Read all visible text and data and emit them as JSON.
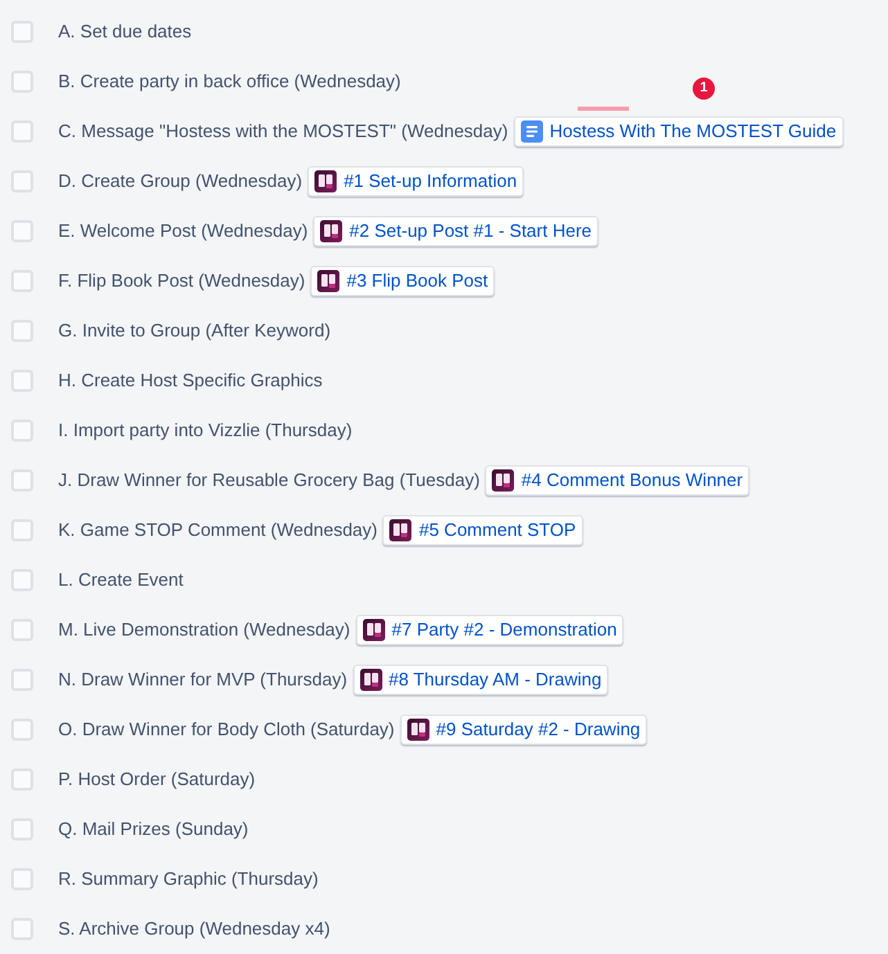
{
  "tasks": [
    {
      "label": "A. Set due dates",
      "checked": false
    },
    {
      "label": "B. Create party in back office (Wednesday)",
      "checked": false
    },
    {
      "label": "C. Message \"Hostess with the MOSTEST\" (Wednesday)",
      "checked": false,
      "link": {
        "kind": "document",
        "text": "Hostess With The MOSTEST Guide"
      }
    },
    {
      "label": "D. Create Group (Wednesday)",
      "checked": false,
      "link": {
        "kind": "board",
        "text": "#1 Set-up Information"
      }
    },
    {
      "label": "E. Welcome Post (Wednesday)",
      "checked": false,
      "link": {
        "kind": "board",
        "text": "#2 Set-up Post #1 - Start Here"
      }
    },
    {
      "label": "F. Flip Book Post (Wednesday)",
      "checked": false,
      "link": {
        "kind": "board",
        "text": "#3 Flip Book Post"
      }
    },
    {
      "label": "G. Invite to Group (After Keyword)",
      "checked": false
    },
    {
      "label": "H. Create Host Specific Graphics",
      "checked": false
    },
    {
      "label": "I. Import party into Vizzlie (Thursday)",
      "checked": false
    },
    {
      "label": "J. Draw Winner for Reusable Grocery Bag (Tuesday)",
      "checked": false,
      "link": {
        "kind": "board",
        "text": "#4 Comment Bonus Winner"
      }
    },
    {
      "label": "K. Game STOP Comment (Wednesday)",
      "checked": false,
      "link": {
        "kind": "board",
        "text": "#5 Comment STOP"
      }
    },
    {
      "label": "L. Create Event",
      "checked": false
    },
    {
      "label": "M. Live Demonstration (Wednesday)",
      "checked": false,
      "link": {
        "kind": "board",
        "text": "#7 Party #2 - Demonstration"
      }
    },
    {
      "label": "N. Draw Winner for MVP (Thursday)",
      "checked": false,
      "link": {
        "kind": "board",
        "text": "#8 Thursday AM - Drawing"
      }
    },
    {
      "label": "O. Draw Winner for Body Cloth (Saturday)",
      "checked": false,
      "link": {
        "kind": "board",
        "text": "#9 Saturday #2 - Drawing"
      }
    },
    {
      "label": "P. Host Order (Saturday)",
      "checked": false
    },
    {
      "label": "Q. Mail Prizes (Sunday)",
      "checked": false
    },
    {
      "label": "R. Summary Graphic (Thursday)",
      "checked": false
    },
    {
      "label": "S. Archive Group (Wednesday x4)",
      "checked": false
    }
  ],
  "notification_badge": {
    "count": "1"
  }
}
